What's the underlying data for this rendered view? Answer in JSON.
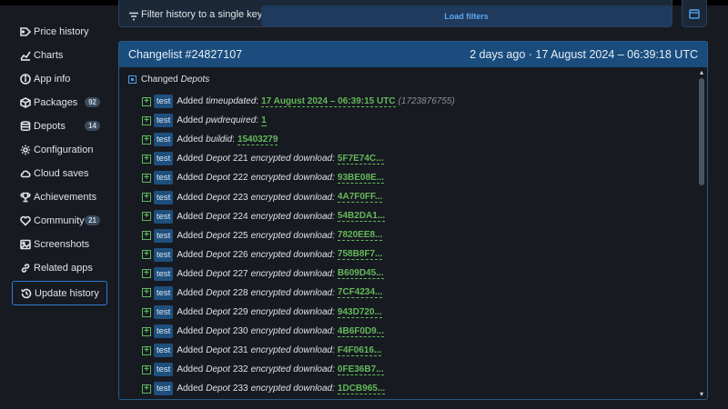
{
  "sidebar": {
    "items": [
      {
        "label": "Price history",
        "icon": "price-tag-icon",
        "badge": null
      },
      {
        "label": "Charts",
        "icon": "chart-line-icon",
        "badge": null
      },
      {
        "label": "App info",
        "icon": "info-icon",
        "badge": null
      },
      {
        "label": "Packages",
        "icon": "package-icon",
        "badge": "92"
      },
      {
        "label": "Depots",
        "icon": "database-icon",
        "badge": "14"
      },
      {
        "label": "Configuration",
        "icon": "gear-icon",
        "badge": null
      },
      {
        "label": "Cloud saves",
        "icon": "cloud-icon",
        "badge": null
      },
      {
        "label": "Achievements",
        "icon": "trophy-icon",
        "badge": null
      },
      {
        "label": "Community",
        "icon": "heart-icon",
        "badge": "21"
      },
      {
        "label": "Screenshots",
        "icon": "image-icon",
        "badge": null
      },
      {
        "label": "Related apps",
        "icon": "link-icon",
        "badge": null
      },
      {
        "label": "Update history",
        "icon": "history-icon",
        "badge": null,
        "active": true
      }
    ]
  },
  "filter": {
    "label": "Filter history to a single key",
    "load_button": "Load filters"
  },
  "changelist": {
    "title": "Changelist #24827107",
    "time": "2 days ago · 17 August 2024 – 06:39:18 UTC",
    "changed_prefix": "Changed",
    "changed_key": "Depots",
    "entries": [
      {
        "tag": "test",
        "action": "Added",
        "key": "timeupdated",
        "value": "17 August 2024 – 06:39:15 UTC",
        "extra": "(1723876755)"
      },
      {
        "tag": "test",
        "action": "Added",
        "key": "pwdrequired",
        "value": "1"
      },
      {
        "tag": "test",
        "action": "Added",
        "key": "buildid",
        "value": "15403279"
      },
      {
        "tag": "test",
        "action": "Added",
        "depot": "221",
        "suffix": "encrypted download:",
        "value": "5F7E74C..."
      },
      {
        "tag": "test",
        "action": "Added",
        "depot": "222",
        "suffix": "encrypted download:",
        "value": "93BE08E..."
      },
      {
        "tag": "test",
        "action": "Added",
        "depot": "223",
        "suffix": "encrypted download:",
        "value": "4A7F0FF..."
      },
      {
        "tag": "test",
        "action": "Added",
        "depot": "224",
        "suffix": "encrypted download:",
        "value": "54B2DA1..."
      },
      {
        "tag": "test",
        "action": "Added",
        "depot": "225",
        "suffix": "encrypted download:",
        "value": "7820EE8..."
      },
      {
        "tag": "test",
        "action": "Added",
        "depot": "226",
        "suffix": "encrypted download:",
        "value": "758B8F7..."
      },
      {
        "tag": "test",
        "action": "Added",
        "depot": "227",
        "suffix": "encrypted download:",
        "value": "B609D45..."
      },
      {
        "tag": "test",
        "action": "Added",
        "depot": "228",
        "suffix": "encrypted download:",
        "value": "7CF4234..."
      },
      {
        "tag": "test",
        "action": "Added",
        "depot": "229",
        "suffix": "encrypted download:",
        "value": "943D720..."
      },
      {
        "tag": "test",
        "action": "Added",
        "depot": "230",
        "suffix": "encrypted download:",
        "value": "4B6F0D9..."
      },
      {
        "tag": "test",
        "action": "Added",
        "depot": "231",
        "suffix": "encrypted download:",
        "value": "F4F0616..."
      },
      {
        "tag": "test",
        "action": "Added",
        "depot": "232",
        "suffix": "encrypted download:",
        "value": "0FE36B7..."
      },
      {
        "tag": "test",
        "action": "Added",
        "depot": "233",
        "suffix": "encrypted download:",
        "value": "1DCB965..."
      }
    ]
  },
  "depot_word": "Depot",
  "colors": {
    "background": "#171a21",
    "panel_header": "#1a4d7e",
    "accent_blue": "#2f7bd1",
    "value_green": "#64b85a",
    "tag_bg": "#1f4f7d"
  }
}
